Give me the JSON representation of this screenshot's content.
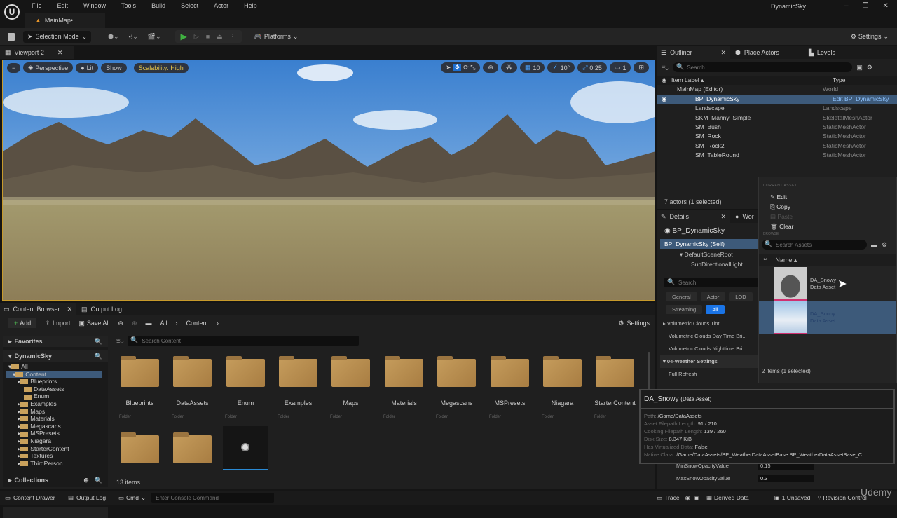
{
  "app": {
    "project": "DynamicSky",
    "level_tab": "MainMap•",
    "menu": [
      "File",
      "Edit",
      "Window",
      "Tools",
      "Build",
      "Select",
      "Actor",
      "Help"
    ]
  },
  "toolbar": {
    "selection_mode": "Selection Mode",
    "platforms": "Platforms",
    "settings": "Settings"
  },
  "viewport": {
    "tab": "Viewport 2",
    "perspective": "Perspective",
    "lit": "Lit",
    "show": "Show",
    "scalability": "Scalability: High",
    "grid": "10",
    "angle": "10°",
    "scale": "0.25",
    "camera": "1"
  },
  "outliner": {
    "tabs": [
      "Outliner",
      "Place Actors",
      "Levels"
    ],
    "search_placeholder": "Search...",
    "col_label": "Item Label ▴",
    "col_type": "Type",
    "rows": [
      {
        "label": "MainMap (Editor)",
        "type": "World"
      },
      {
        "label": "BP_DynamicSky",
        "type": "Edit BP_DynamicSky"
      },
      {
        "label": "Landscape",
        "type": "Landscape"
      },
      {
        "label": "SKM_Manny_Simple",
        "type": "SkeletalMeshActor"
      },
      {
        "label": "SM_Bush",
        "type": "StaticMeshActor"
      },
      {
        "label": "SM_Rock",
        "type": "StaticMeshActor"
      },
      {
        "label": "SM_Rock2",
        "type": "StaticMeshActor"
      },
      {
        "label": "SM_TableRound",
        "type": "StaticMeshActor"
      }
    ],
    "status": "7 actors (1 selected)"
  },
  "details": {
    "tab": "Details",
    "tab2": "Wor",
    "title": "BP_DynamicSky",
    "self": "BP_DynamicSky (Self)",
    "root": "DefaultSceneRoot",
    "light": "SunDirectionalLight",
    "search_placeholder": "Search",
    "filters": [
      "General",
      "Actor",
      "LOD",
      "Streaming",
      "All"
    ],
    "props": [
      "Volumetric Clouds Tint",
      "Volumetric Clouds Day Time Bri...",
      "Volumetric Clouds Nighttime Bri..."
    ],
    "section": "04-Weather Settings",
    "full_refresh": "Full Refresh",
    "min_snow_label": "MinSnowOpacityValue",
    "min_snow": "0.15",
    "max_snow_label": "MaxSnowOpacityValue",
    "max_snow": "0.3"
  },
  "picker": {
    "current_asset": "CURRENT ASSET",
    "edit": "Edit",
    "copy": "Copy",
    "paste": "Paste",
    "clear": "Clear",
    "browse": "BROWSE",
    "search_placeholder": "Search Assets",
    "col_name": "Name ▴",
    "assets": [
      {
        "name": "DA_Snowy",
        "type": "Data Asset"
      },
      {
        "name": "DA_Sunny",
        "type": "Data Asset"
      }
    ],
    "status": "2 items (1 selected)"
  },
  "tooltip": {
    "name": "DA_Snowy",
    "kind": "(Data Asset)",
    "lines": [
      {
        "k": "Path:",
        "v": "/Game/DataAssets"
      },
      {
        "k": "Asset Filepath Length:",
        "v": "91 / 210"
      },
      {
        "k": "Cooking Filepath Length:",
        "v": "139 / 260"
      },
      {
        "k": "Disk Size:",
        "v": "8.347 KiB"
      },
      {
        "k": "Has Virtualized Data:",
        "v": "False"
      },
      {
        "k": "Native Class:",
        "v": "/Game/DataAssets/BP_WeatherDataAssetBase.BP_WeatherDataAssetBase_C"
      }
    ]
  },
  "content": {
    "tab": "Content Browser",
    "tab2": "Output Log",
    "add": "Add",
    "import": "Import",
    "save_all": "Save All",
    "crumbs": [
      "All",
      "Content"
    ],
    "settings": "Settings",
    "favorites": "Favorites",
    "project": "DynamicSky",
    "collections": "Collections",
    "search_placeholder": "Search Content",
    "tree": [
      "All",
      "Content",
      "Blueprints",
      "DataAssets",
      "Enum",
      "Examples",
      "Maps",
      "Materials",
      "Megascans",
      "MSPresets",
      "Niagara",
      "StarterContent",
      "Textures",
      "ThirdPerson"
    ],
    "folders": [
      "Blueprints",
      "DataAssets",
      "Enum",
      "Examples",
      "Maps",
      "Materials",
      "Megascans",
      "MSPresets",
      "Niagara",
      "StarterContent"
    ],
    "folder_type": "Folder",
    "count": "13 items"
  },
  "statusbar": {
    "drawer": "Content Drawer",
    "output": "Output Log",
    "cmd": "Cmd",
    "console_placeholder": "Enter Console Command",
    "trace": "Trace",
    "derived": "Derived Data",
    "unsaved": "1 Unsaved",
    "revision": "Revision Control"
  },
  "watermark": "Udemy"
}
